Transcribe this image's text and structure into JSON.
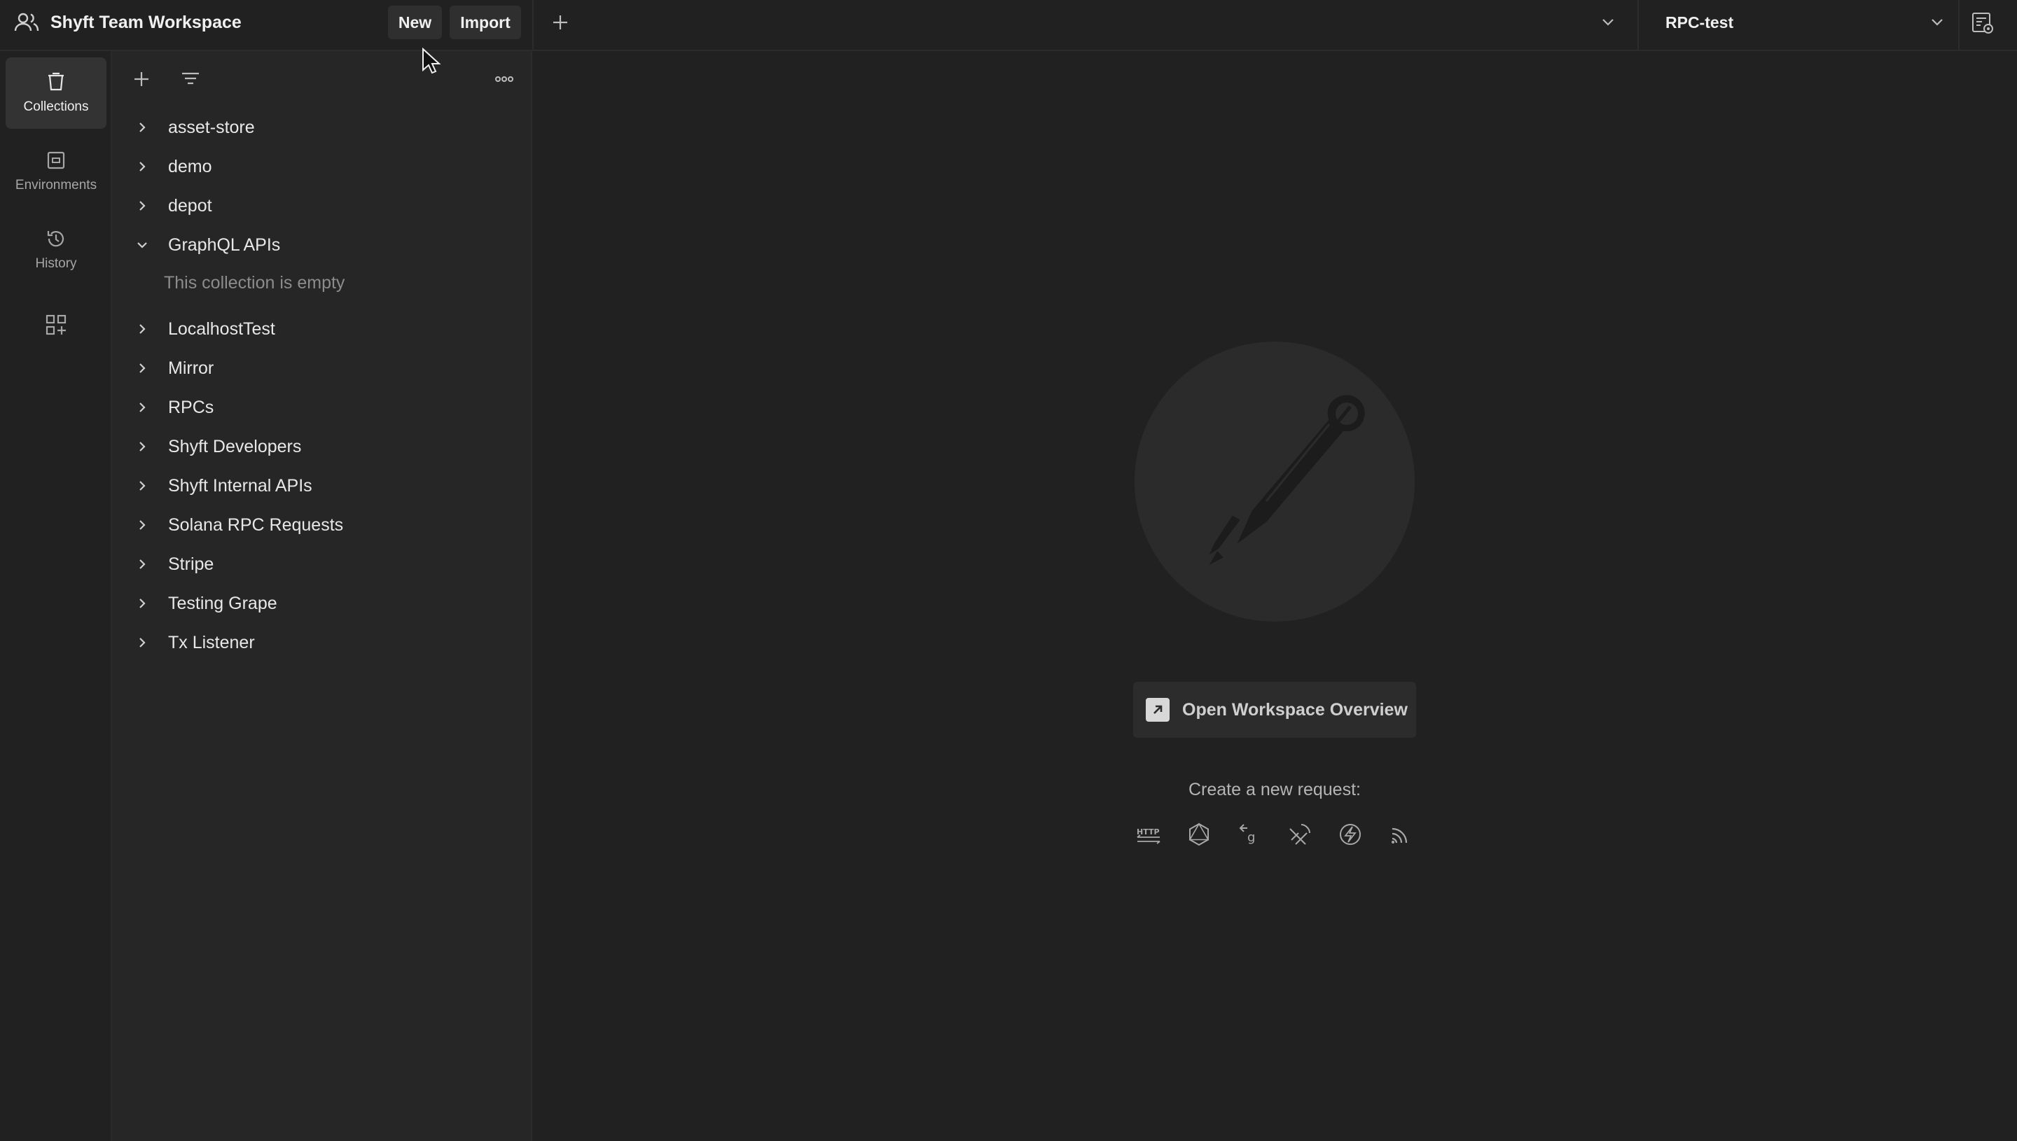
{
  "header": {
    "workspace_name": "Shyft Team Workspace",
    "new_label": "New",
    "import_label": "Import",
    "environment": "RPC-test"
  },
  "rail": {
    "items": [
      {
        "label": "Collections",
        "icon": "collections-icon",
        "active": true
      },
      {
        "label": "Environments",
        "icon": "environments-icon"
      },
      {
        "label": "History",
        "icon": "history-icon"
      }
    ]
  },
  "sidebar": {
    "collections": [
      {
        "name": "asset-store",
        "expanded": false
      },
      {
        "name": "demo",
        "expanded": false
      },
      {
        "name": "depot",
        "expanded": false
      },
      {
        "name": "GraphQL APIs",
        "expanded": true,
        "empty_text": "This collection is empty"
      },
      {
        "name": "LocalhostTest",
        "expanded": false
      },
      {
        "name": "Mirror",
        "expanded": false
      },
      {
        "name": "RPCs",
        "expanded": false
      },
      {
        "name": "Shyft Developers",
        "expanded": false
      },
      {
        "name": "Shyft Internal APIs",
        "expanded": false
      },
      {
        "name": "Solana RPC Requests",
        "expanded": false
      },
      {
        "name": "Stripe",
        "expanded": false
      },
      {
        "name": "Testing Grape",
        "expanded": false
      },
      {
        "name": "Tx Listener",
        "expanded": false
      }
    ]
  },
  "main": {
    "overview_button": "Open Workspace Overview",
    "create_label": "Create a new request:",
    "request_types": [
      "http-icon",
      "graphql-icon",
      "grpc-icon",
      "websocket-icon",
      "socketio-icon",
      "mqtt-icon"
    ]
  },
  "colors": {
    "background": "#212121",
    "sidebar": "#262626",
    "active_rail": "#333333",
    "text": "#e6e6e6",
    "muted": "#8c8c8c"
  }
}
